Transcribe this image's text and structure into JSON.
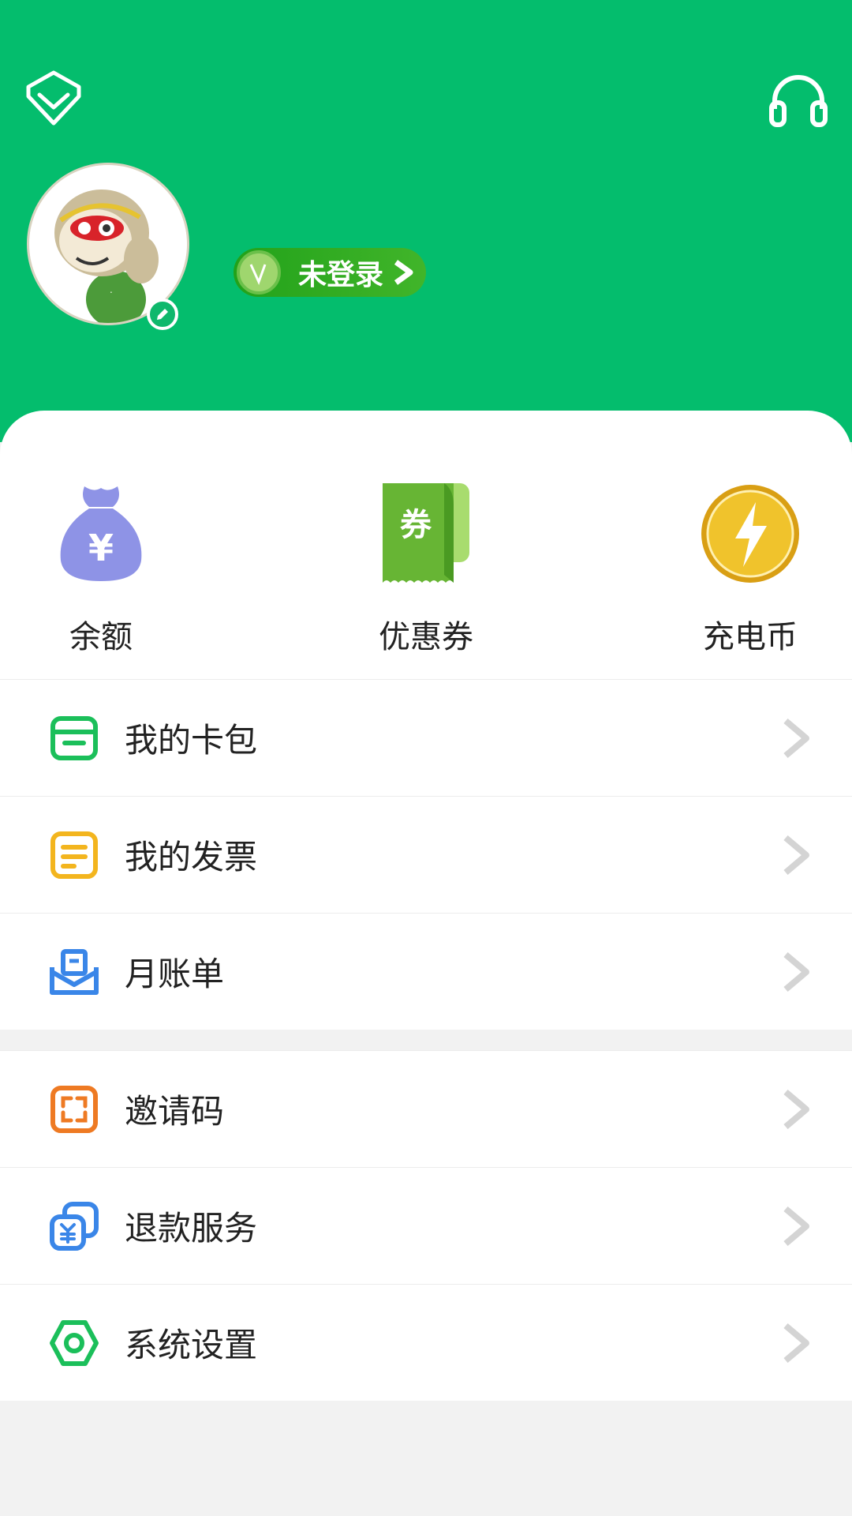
{
  "header": {
    "login_label": "未登录",
    "login_badge": "V"
  },
  "quick_actions": [
    {
      "label": "余额",
      "icon": "money-bag-icon",
      "color": "#8e93e6"
    },
    {
      "label": "优惠券",
      "icon": "coupon-icon",
      "color": "#7cc444"
    },
    {
      "label": "充电币",
      "icon": "lightning-coin-icon",
      "color": "#e5ad1c"
    }
  ],
  "menu_group_1": [
    {
      "label": "我的卡包",
      "icon": "card-wallet-icon",
      "color": "#1bbf5a"
    },
    {
      "label": "我的发票",
      "icon": "invoice-icon",
      "color": "#f3b51e"
    },
    {
      "label": "月账单",
      "icon": "monthly-bill-icon",
      "color": "#3a86e8"
    }
  ],
  "menu_group_2": [
    {
      "label": "邀请码",
      "icon": "invite-code-icon",
      "color": "#ee7a23"
    },
    {
      "label": "退款服务",
      "icon": "refund-icon",
      "color": "#3a86e8"
    },
    {
      "label": "系统设置",
      "icon": "settings-hex-icon",
      "color": "#1bbf5a"
    }
  ],
  "colors": {
    "brand": "#04bd6d",
    "background": "#f2f2f2"
  }
}
